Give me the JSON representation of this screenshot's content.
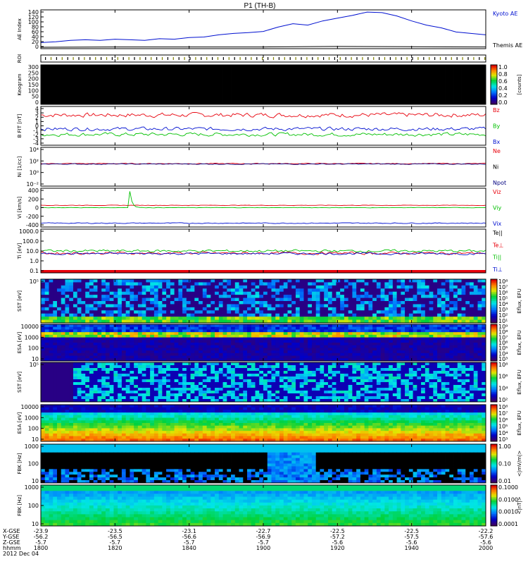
{
  "title": "P1 (TH-B)",
  "footer": {
    "row_labels": [
      "X-GSE",
      "Y-GSE",
      "Z-GSE",
      "hhmm",
      "2012 Dec 04"
    ],
    "columns": [
      {
        "x": "-23.9",
        "y": "-56.2",
        "z": "-5.7",
        "t": "1800"
      },
      {
        "x": "-23.5",
        "y": "-56.5",
        "z": "-5.7",
        "t": "1820"
      },
      {
        "x": "-23.1",
        "y": "-56.6",
        "z": "-5.7",
        "t": "1840"
      },
      {
        "x": "-22.7",
        "y": "-56.9",
        "z": "-5.7",
        "t": "1900"
      },
      {
        "x": "-22.5",
        "y": "-57.2",
        "z": "-5.6",
        "t": "1920"
      },
      {
        "x": "-22.5",
        "y": "-57.5",
        "z": "-5.6",
        "t": "1940"
      },
      {
        "x": "-22.2",
        "y": "-57.6",
        "z": "-5.6",
        "t": "2000"
      }
    ]
  },
  "colors": {
    "red": "#e8000b",
    "green": "#00c000",
    "blue": "#0010d0",
    "black": "#000000",
    "navy": "#000080"
  },
  "chart_data": [
    {
      "type": "line",
      "id": "ae",
      "ylabel": "AE Index",
      "yticks": [
        "140",
        "120",
        "100",
        "80",
        "60",
        "40",
        "20",
        "0"
      ],
      "ylim": [
        0,
        140
      ],
      "series": [
        {
          "name": "Kyoto AE",
          "color": "#0010d0",
          "x": [
            0,
            4,
            8,
            12,
            16,
            20,
            24,
            28,
            32,
            36,
            40,
            44,
            48,
            52,
            56,
            60,
            64,
            68,
            72,
            76,
            80,
            84,
            88,
            92,
            96,
            100,
            104,
            108,
            112,
            116,
            120
          ],
          "values": [
            22,
            25,
            30,
            32,
            30,
            34,
            32,
            30,
            36,
            34,
            40,
            42,
            50,
            55,
            58,
            62,
            78,
            90,
            85,
            100,
            110,
            120,
            132,
            130,
            118,
            100,
            85,
            75,
            60,
            55,
            50
          ]
        },
        {
          "name": "Themis AE",
          "color": "#000000",
          "x": [
            0,
            20,
            40,
            60,
            80,
            100,
            120
          ],
          "values": [
            5,
            6,
            6,
            6,
            8,
            7,
            6
          ]
        }
      ]
    },
    {
      "type": "table",
      "id": "roi",
      "ylabel": "ROI"
    },
    {
      "type": "heatmap",
      "id": "keogram",
      "ylabel": "Keogram",
      "yticks": [
        "300",
        "250",
        "200",
        "150",
        "100",
        "50",
        "0"
      ],
      "colorbar": {
        "label": "[counts]",
        "ticks": [
          "1.0",
          "0.8",
          "0.6",
          "0.4",
          "0.2",
          "0.0"
        ]
      }
    },
    {
      "type": "line",
      "id": "bfield",
      "ylabel": "B FIT [nT]",
      "yticks": [
        "4",
        "3",
        "2",
        "1",
        "0",
        "-1",
        "-2",
        "-3",
        "-4"
      ],
      "ylim": [
        -4,
        4
      ],
      "series": [
        {
          "name": "Bz",
          "color": "#e8000b"
        },
        {
          "name": "By",
          "color": "#00c000"
        },
        {
          "name": "Bx",
          "color": "#0010d0"
        }
      ]
    },
    {
      "type": "line",
      "id": "density",
      "ylabel": "Ni [1/cc]",
      "yticks": [
        "10⁴",
        "10²",
        "10⁰",
        "10⁻²"
      ],
      "series": [
        {
          "name": "Ne",
          "color": "#e8000b"
        },
        {
          "name": "Ni",
          "color": "#000000"
        },
        {
          "name": "Npot",
          "color": "#000080"
        }
      ]
    },
    {
      "type": "line",
      "id": "velocity",
      "ylabel": "Vi [km/s]",
      "yticks": [
        "400",
        "200",
        "0",
        "-200",
        "-400"
      ],
      "ylim": [
        -400,
        400
      ],
      "series": [
        {
          "name": "Viz",
          "color": "#e8000b"
        },
        {
          "name": "Viy",
          "color": "#00c000"
        },
        {
          "name": "Vix",
          "color": "#0010d0"
        }
      ]
    },
    {
      "type": "line",
      "id": "temp",
      "ylabel": "Ti [eV]",
      "yticks": [
        "1000.0",
        "100.0",
        "10.0",
        "1.0",
        "0.1"
      ],
      "series": [
        {
          "name": "Te||",
          "color": "#000000"
        },
        {
          "name": "Te⊥",
          "color": "#e8000b"
        },
        {
          "name": "Ti||",
          "color": "#00c000"
        },
        {
          "name": "Ti⊥",
          "color": "#0010d0"
        }
      ]
    },
    {
      "type": "heatmap",
      "id": "sst_e",
      "ylabel": "SST [eV]",
      "yticks": [
        "10⁵"
      ],
      "colorbar": {
        "label": "Eflux, EFU",
        "ticks": [
          "10⁸",
          "10⁷",
          "10⁶",
          "10⁵",
          "10⁴",
          "10³",
          "10²",
          "10¹"
        ]
      }
    },
    {
      "type": "heatmap",
      "id": "esa_e",
      "ylabel": "ESA [eV]",
      "yticks": [
        "10000",
        "1000",
        "100",
        "10"
      ],
      "colorbar": {
        "label": "Eflux, EFU",
        "ticks": [
          "10⁹",
          "10⁸",
          "10⁷",
          "10⁶",
          "10⁵",
          "10⁴",
          "10³"
        ]
      }
    },
    {
      "type": "heatmap",
      "id": "sst_i",
      "ylabel": "SST [eV]",
      "yticks": [
        "10⁵"
      ],
      "colorbar": {
        "label": "Eflux, EFU",
        "ticks": [
          "10⁸",
          "10⁶",
          "10⁴",
          "10²"
        ]
      }
    },
    {
      "type": "heatmap",
      "id": "esa_i",
      "ylabel": "ESA [eV]",
      "yticks": [
        "10000",
        "1000",
        "100",
        "10"
      ],
      "colorbar": {
        "label": "Eflux, EFU",
        "ticks": [
          "10⁸",
          "10⁷",
          "10⁶",
          "10⁵",
          "10⁴",
          "10³"
        ]
      }
    },
    {
      "type": "heatmap",
      "id": "fbk_e",
      "ylabel": "FBK [Hz]",
      "yticks": [
        "1000",
        "100",
        "10"
      ],
      "colorbar": {
        "label": "<|mV/m|>",
        "ticks": [
          "1.00",
          "0.10",
          "0.01"
        ]
      }
    },
    {
      "type": "heatmap",
      "id": "fbk_b",
      "ylabel": "FBK [Hz]",
      "yticks": [
        "1000",
        "100",
        "10"
      ],
      "colorbar": {
        "label": "<|nT|>",
        "ticks": [
          "0.1000",
          "0.0100",
          "0.0010",
          "0.0001"
        ]
      }
    }
  ]
}
